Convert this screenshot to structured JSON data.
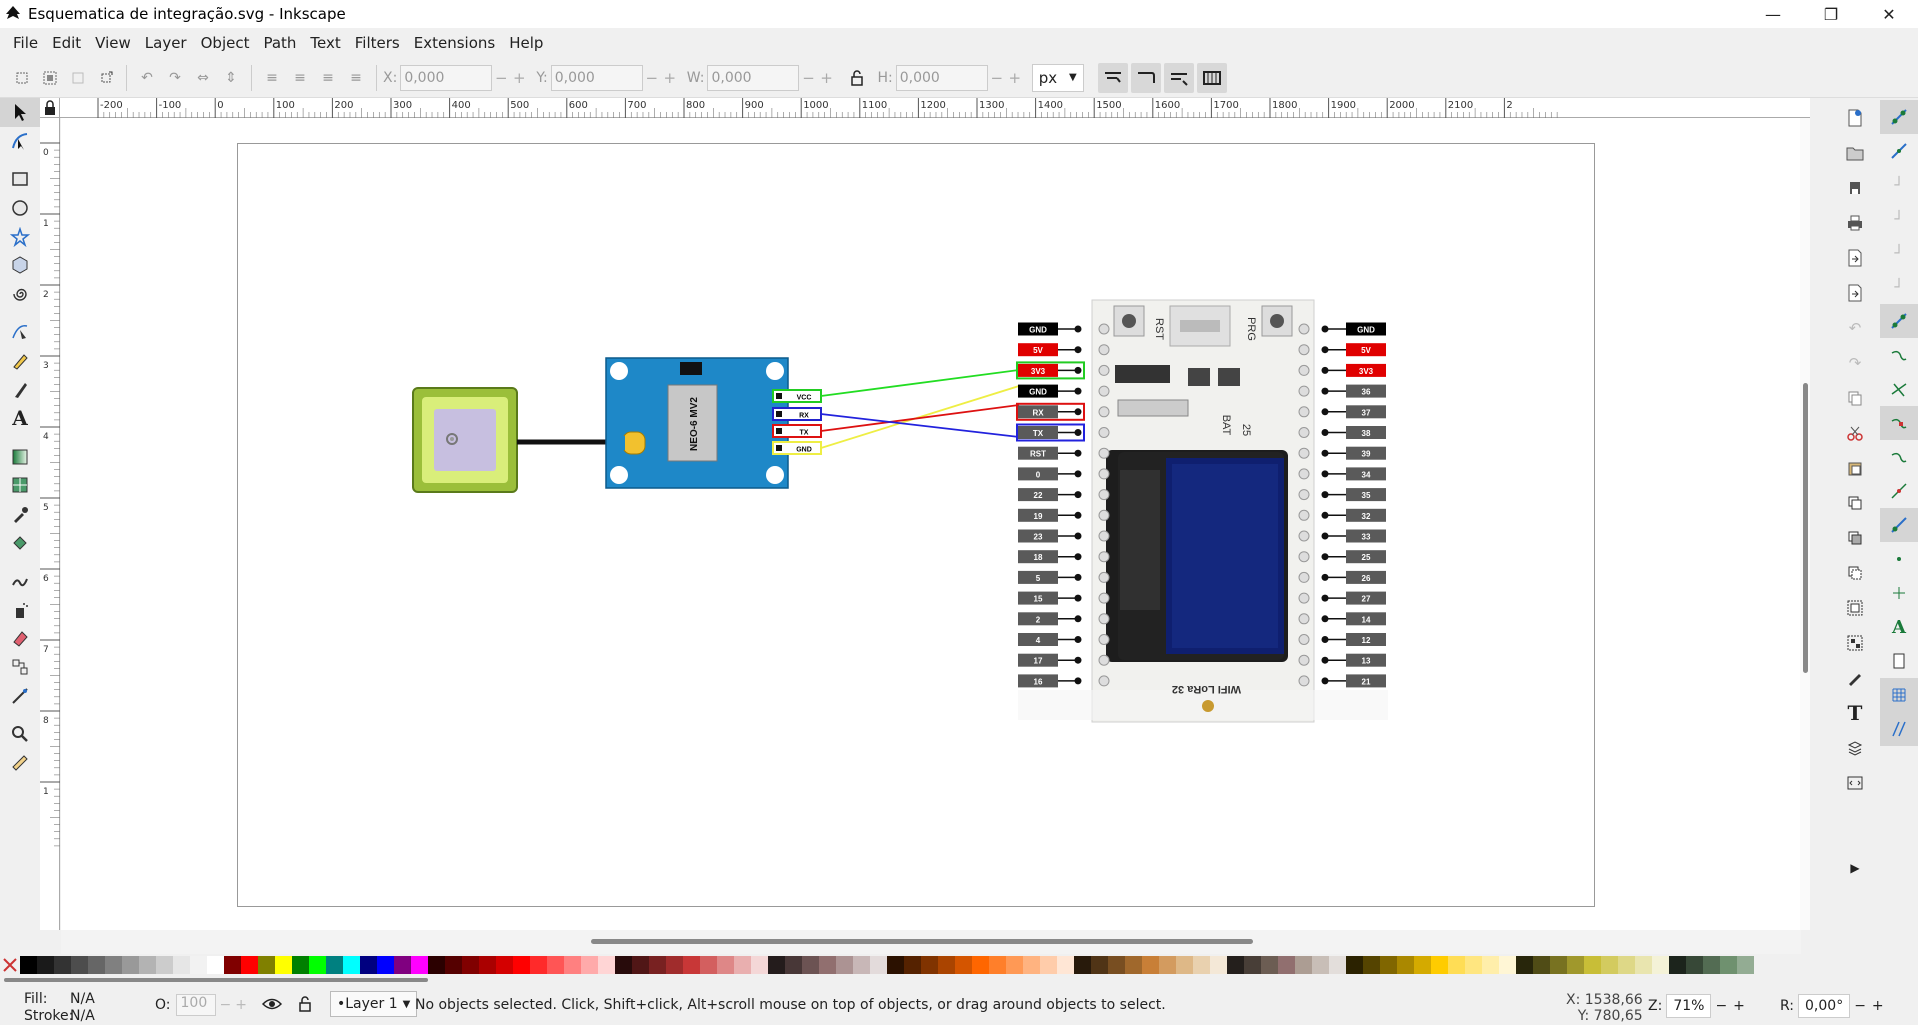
{
  "window": {
    "title": "Esquematica de integração.svg - Inkscape",
    "minimize": "—",
    "maximize": "❐",
    "close": "✕"
  },
  "menu": [
    "File",
    "Edit",
    "View",
    "Layer",
    "Object",
    "Path",
    "Text",
    "Filters",
    "Extensions",
    "Help"
  ],
  "toolbar": {
    "x_label": "X:",
    "x_value": "0,000",
    "y_label": "Y:",
    "y_value": "0,000",
    "w_label": "W:",
    "w_value": "0,000",
    "h_label": "H:",
    "h_value": "0,000",
    "unit": "px",
    "minus": "−",
    "plus": "+"
  },
  "ruler_h_labels": [
    "-200",
    "-100",
    "0",
    "100",
    "200",
    "300",
    "400",
    "500",
    "600",
    "700",
    "800",
    "900",
    "1000",
    "1100",
    "1200",
    "1300",
    "1400",
    "1500",
    "1600",
    "1700",
    "1800",
    "1900",
    "2000",
    "2100",
    "2"
  ],
  "ruler_v_labels": [
    "0",
    "1",
    "2",
    "3",
    "4",
    "5",
    "6",
    "7",
    "8",
    "1"
  ],
  "drawing": {
    "gps_module_label": "NEO-6 MV2",
    "gps_pins": [
      "VCC",
      "RX",
      "TX",
      "GND"
    ],
    "board_label": "WIFI LoRa 32",
    "board_silk_rst": "RST",
    "board_silk_prg": "PRG",
    "board_silk_bat": "BAT",
    "board_silk_25": "25",
    "left_pins": [
      "GND",
      "5V",
      "3V3",
      "GND",
      "RX",
      "TX",
      "RST",
      "0",
      "22",
      "19",
      "23",
      "18",
      "5",
      "15",
      "2",
      "4",
      "17",
      "16"
    ],
    "right_pins": [
      "GND",
      "5V",
      "3V3",
      "36",
      "37",
      "38",
      "39",
      "34",
      "35",
      "32",
      "33",
      "25",
      "26",
      "27",
      "14",
      "12",
      "13",
      "21"
    ],
    "wire_colors": {
      "vcc": "#22dd22",
      "rx": "#dd1111",
      "tx": "#2222dd",
      "gnd": "#eeee44"
    }
  },
  "palette": [
    "#000000",
    "#1a1a1a",
    "#333333",
    "#4d4d4d",
    "#666666",
    "#808080",
    "#999999",
    "#b3b3b3",
    "#cccccc",
    "#e6e6e6",
    "#f2f2f2",
    "#ffffff",
    "#800000",
    "#ff0000",
    "#808000",
    "#ffff00",
    "#008000",
    "#00ff00",
    "#008080",
    "#00ffff",
    "#000080",
    "#0000ff",
    "#800080",
    "#ff00ff",
    "#2b0000",
    "#550000",
    "#800000",
    "#aa0000",
    "#d40000",
    "#ff0000",
    "#ff2a2a",
    "#ff5555",
    "#ff8080",
    "#ffaaaa",
    "#ffd5d5",
    "#280b0b",
    "#501616",
    "#782121",
    "#a02c2c",
    "#c83737",
    "#d35f5f",
    "#de8787",
    "#e9afaf",
    "#f4d7d7",
    "#241c1c",
    "#483737",
    "#6c5353",
    "#916f6f",
    "#ac9393",
    "#c8b7b7",
    "#e3dbdb",
    "#2b1100",
    "#552200",
    "#803300",
    "#aa4400",
    "#d45500",
    "#ff6600",
    "#ff7f2a",
    "#ff9955",
    "#ffb380",
    "#ffccaa",
    "#ffe6d5",
    "#281a0b",
    "#503416",
    "#784e21",
    "#a0682c",
    "#c87f37",
    "#d39b5f",
    "#deb887",
    "#e9d1af",
    "#f4e8d7",
    "#241f1c",
    "#483e37",
    "#6c5d53",
    "#916f6f",
    "#ac9d93",
    "#c8beb7",
    "#e3dedb",
    "#2b2200",
    "#554400",
    "#806600",
    "#aa8800",
    "#d4aa00",
    "#ffcc00",
    "#ffdd55",
    "#ffe680",
    "#ffeeaa",
    "#fff6d5",
    "#28260b",
    "#504c16",
    "#787221",
    "#a0982c",
    "#c8be37",
    "#d3cb5f",
    "#ded887",
    "#e9e5af",
    "#f4f2d7",
    "#1c241c",
    "#374837",
    "#536c53",
    "#6f916f",
    "#93ac93"
  ],
  "status": {
    "fill_label": "Fill:",
    "fill_value": "N/A",
    "stroke_label": "Stroke:",
    "stroke_value": "N/A",
    "opacity_label": "O:",
    "opacity_value": "100",
    "layer": "•Layer 1",
    "message": "No objects selected. Click, Shift+click, Alt+scroll mouse on top of objects, or drag around objects to select.",
    "x_coord": "X: 1538,66",
    "y_coord": "Y:   780,65",
    "zoom_label": "Z:",
    "zoom_value": "71%",
    "rot_label": "R:",
    "rot_value": "0,00°"
  }
}
